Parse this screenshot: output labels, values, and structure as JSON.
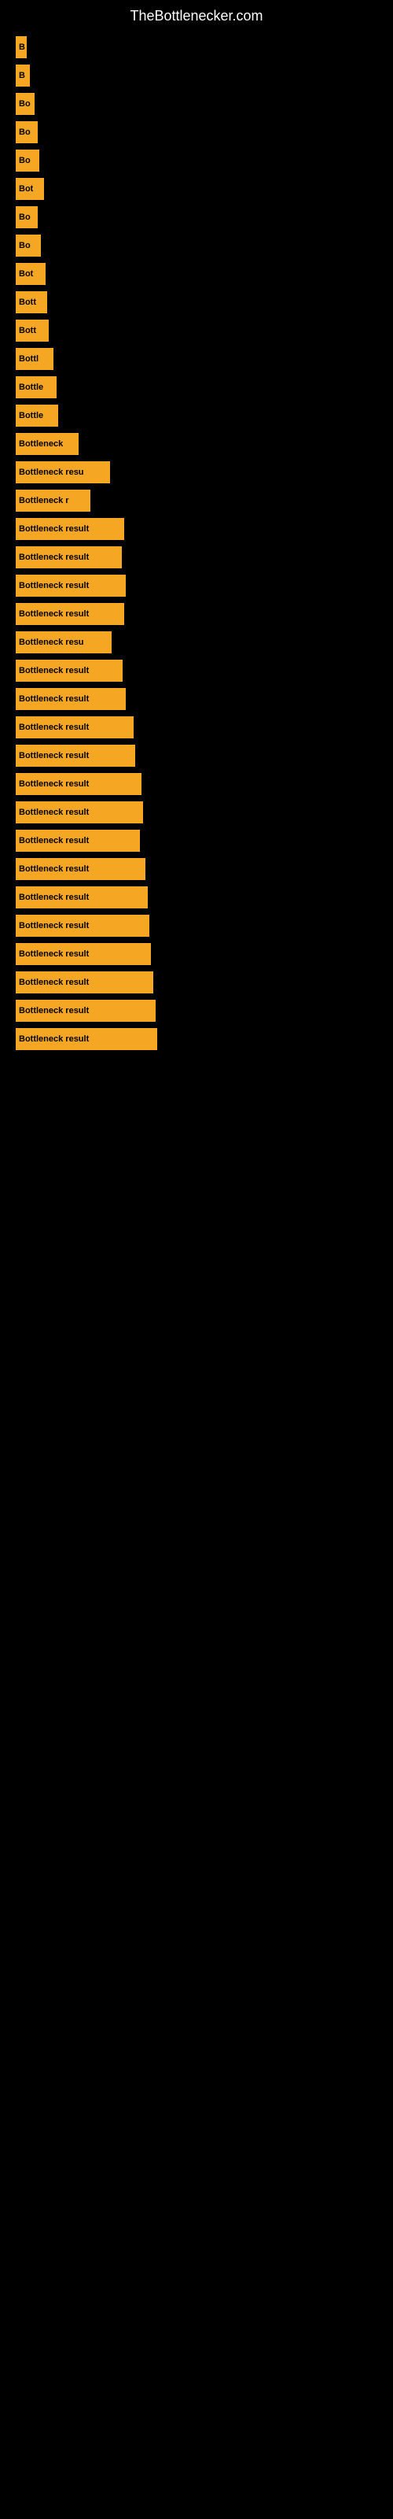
{
  "site": {
    "title": "TheBottlenecker.com"
  },
  "bars": [
    {
      "label": "B",
      "width": 14
    },
    {
      "label": "B",
      "width": 18
    },
    {
      "label": "Bo",
      "width": 24
    },
    {
      "label": "Bo",
      "width": 28
    },
    {
      "label": "Bo",
      "width": 30
    },
    {
      "label": "Bot",
      "width": 36
    },
    {
      "label": "Bo",
      "width": 28
    },
    {
      "label": "Bo",
      "width": 32
    },
    {
      "label": "Bot",
      "width": 38
    },
    {
      "label": "Bott",
      "width": 40
    },
    {
      "label": "Bott",
      "width": 42
    },
    {
      "label": "Bottl",
      "width": 48
    },
    {
      "label": "Bottle",
      "width": 52
    },
    {
      "label": "Bottle",
      "width": 54
    },
    {
      "label": "Bottleneck",
      "width": 80
    },
    {
      "label": "Bottleneck resu",
      "width": 120
    },
    {
      "label": "Bottleneck r",
      "width": 95
    },
    {
      "label": "Bottleneck result",
      "width": 138
    },
    {
      "label": "Bottleneck result",
      "width": 135
    },
    {
      "label": "Bottleneck result",
      "width": 140
    },
    {
      "label": "Bottleneck result",
      "width": 138
    },
    {
      "label": "Bottleneck resu",
      "width": 122
    },
    {
      "label": "Bottleneck result",
      "width": 136
    },
    {
      "label": "Bottleneck result",
      "width": 140
    },
    {
      "label": "Bottleneck result",
      "width": 150
    },
    {
      "label": "Bottleneck result",
      "width": 152
    },
    {
      "label": "Bottleneck result",
      "width": 160
    },
    {
      "label": "Bottleneck result",
      "width": 162
    },
    {
      "label": "Bottleneck result",
      "width": 158
    },
    {
      "label": "Bottleneck result",
      "width": 165
    },
    {
      "label": "Bottleneck result",
      "width": 168
    },
    {
      "label": "Bottleneck result",
      "width": 170
    },
    {
      "label": "Bottleneck result",
      "width": 172
    },
    {
      "label": "Bottleneck result",
      "width": 175
    },
    {
      "label": "Bottleneck result",
      "width": 178
    },
    {
      "label": "Bottleneck result",
      "width": 180
    }
  ]
}
